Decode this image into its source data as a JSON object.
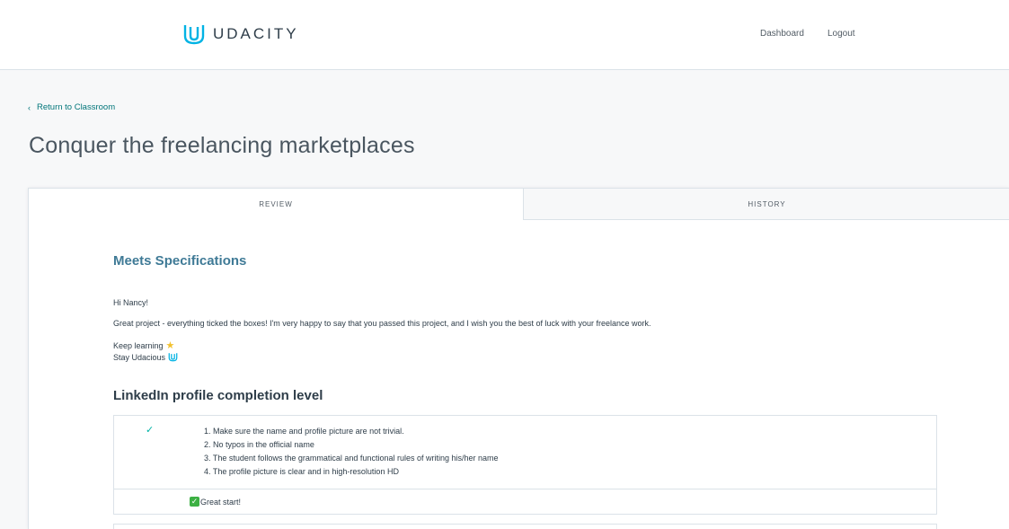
{
  "header": {
    "logo_text": "UDACITY",
    "nav": {
      "dashboard": "Dashboard",
      "logout": "Logout"
    }
  },
  "back_link": {
    "label": "Return to Classroom"
  },
  "page_title": "Conquer the freelancing marketplaces",
  "tabs": [
    {
      "label": "REVIEW",
      "active": true
    },
    {
      "label": "HISTORY",
      "active": false
    }
  ],
  "review": {
    "status": "Meets Specifications",
    "message": {
      "greeting": "Hi Nancy!",
      "body": "Great project - everything ticked the boxes! I'm very happy to say that you passed this project, and I wish you the best of luck with your freelance work.",
      "keep": "Keep learning",
      "stay": "Stay Udacious"
    },
    "sections": [
      {
        "title": "LinkedIn profile completion level",
        "criteria": [
          "1. Make sure the name and profile picture are not trivial.",
          "2. No typos in the official name",
          "3. The student follows the grammatical and functional rules of writing his/her name",
          "4. The profile picture is clear and in high-resolution HD"
        ],
        "comment": "Great start!"
      }
    ]
  },
  "colors": {
    "brand": "#02b3e4",
    "accent": "#3f7a96",
    "link": "#02767a",
    "check": "#02b3a6"
  },
  "icons": {
    "logo": "udacity-u-icon",
    "back": "chevron-left-icon",
    "star": "star-icon",
    "check": "checkmark-icon",
    "comment_check": "check-box-icon"
  }
}
